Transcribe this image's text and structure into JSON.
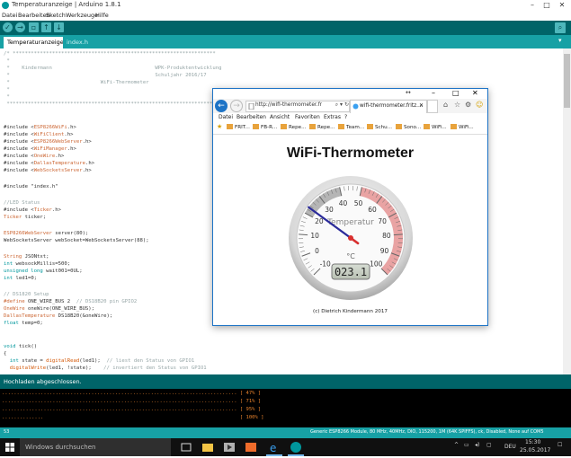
{
  "app": {
    "title": "Temperaturanzeige | Arduino 1.8.1",
    "window_controls": [
      "–",
      "□",
      "✕"
    ]
  },
  "menu": [
    "Datei",
    "Bearbeiten",
    "Sketch",
    "Werkzeuge",
    "Hilfe"
  ],
  "tabs": [
    {
      "label": "Temperaturanzeige",
      "active": true
    },
    {
      "label": "index.h",
      "active": false
    }
  ],
  "editor": {
    "header": [
      "/* *******************************************************************",
      " *",
      " *    Kindermann                                  WPK-Produktentwicklung",
      " *                                                Schuljahr 2016/17",
      " *                              WiFi-Thermometer",
      " *",
      " *",
      " ********************************************************************"
    ],
    "includes": [
      {
        "pre": "#include <",
        "lib": "ESP8266WiFi",
        "post": ".h>"
      },
      {
        "pre": "#include <",
        "lib": "WiFiClient",
        "post": ".h>"
      },
      {
        "pre": "#include <",
        "lib": "ESP8266WebServer",
        "post": ".h>"
      },
      {
        "pre": "#include <",
        "lib": "WiFiManager",
        "post": ".h>"
      },
      {
        "pre": "#include <",
        "lib": "OneWire",
        "post": ".h>"
      },
      {
        "pre": "#include <",
        "lib": "DallasTemperature",
        "post": ".h>"
      },
      {
        "pre": "#include <",
        "lib": "WebSocketsServer",
        "post": ".h>"
      }
    ],
    "include_index": "#include \"index.h\"",
    "led_comment": "//LED Status",
    "ticker_include": {
      "pre": "#include <",
      "lib": "Ticker",
      "post": ".h>"
    },
    "ticker_decl": {
      "type": "Ticker",
      "rest": " ticker;"
    },
    "server_decl": {
      "type": "ESP8266WebServer",
      "rest": " server(80);"
    },
    "ws_decl": "WebSocketsServer webSocket=WebSocketsServer(88);",
    "json_decl": {
      "type": "String",
      "rest": " JSONtxt;"
    },
    "ws_millis": {
      "type": "int",
      "rest": " websockMillis=500;"
    },
    "wait_decl": {
      "type": "unsigned long",
      "rest": " wait001=0UL;"
    },
    "led_decl": {
      "type": "int",
      "rest": " led1=0;"
    },
    "ds_comment": "// DS1820 Setup",
    "define_line": {
      "kw": "#define",
      "rest": " ONE_WIRE_BUS 2  ",
      "cm": "// DS18B20 pin GPIO2"
    },
    "onewire_line": {
      "type": "OneWire",
      "rest": " oneWire(ONE_WIRE_BUS);"
    },
    "dallas_line": {
      "type": "DallasTemperature",
      "rest": " DS18B20(&oneWire);"
    },
    "float_line": {
      "type": "float",
      "rest": " temp=0;"
    },
    "tick_decl": {
      "type": "void",
      "rest": " tick()"
    },
    "brace": "{",
    "state_line": {
      "type": "int",
      "mid": " state = ",
      "fn": "digitalRead",
      "rest": "(led1);  ",
      "cm": "// liest den Status von GPIO1"
    },
    "write_line": {
      "fn": "digitalWrite",
      "rest": "(led1, !state);    ",
      "cm": "// invertiert den Status von GPIO1"
    }
  },
  "status": "Hochladen abgeschlossen.",
  "console": [
    {
      "dots": "...............................................................................",
      "pct": "[ 47% ]"
    },
    {
      "dots": "...............................................................................",
      "pct": "[ 71% ]"
    },
    {
      "dots": "...............................................................................",
      "pct": "[ 95% ]"
    },
    {
      "dots": "..............                                                                 ",
      "pct": "[ 100% ]"
    }
  ],
  "bottom": {
    "line": "53",
    "board": "Generic ESP8266 Module, 80 MHz, 40MHz, DIO, 115200, 1M (64K SPIFFS), ck, Disabled, None auf COM5"
  },
  "taskbar": {
    "search_placeholder": "Windows durchsuchen",
    "time": "15:30",
    "date": "25.05.2017",
    "lang": "DEU"
  },
  "browser": {
    "url": "http://wifi-thermometer.fritz.box/",
    "tab_title": "wifi-thermometer.fritz....",
    "menu": [
      "Datei",
      "Bearbeiten",
      "Ansicht",
      "Favoriten",
      "Extras",
      "?"
    ],
    "favorites": [
      "FRIT...",
      "FB-R...",
      "Repe...",
      "Repe...",
      "Team...",
      "Schu...",
      "Sono...",
      "WiFi...",
      "WiFi..."
    ],
    "heading": "WiFi-Thermometer",
    "gauge": {
      "title": "Temperatur",
      "unit": "°C",
      "min": -10,
      "max": 100,
      "value": 23.1,
      "display": "023.1",
      "ticks": [
        "-10",
        "0",
        "10",
        "20",
        "30",
        "40",
        "50",
        "60",
        "70",
        "80",
        "90",
        "100"
      ],
      "needle_color": "#2a2a9a",
      "warn_color": "#e9a3a3"
    },
    "copyright": "(c) Dietrich Kindermann 2017"
  }
}
